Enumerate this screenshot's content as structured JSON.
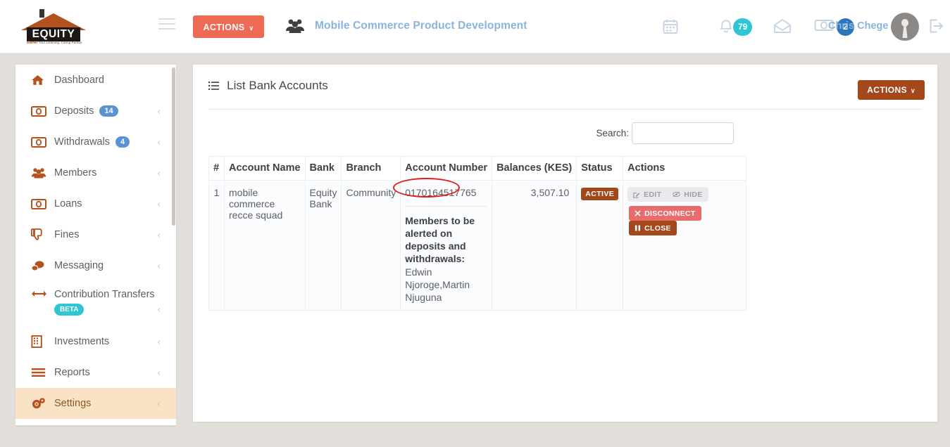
{
  "brand": {
    "logo_name": "EQUITY",
    "logo_tagline_bold": "Bank",
    "logo_tagline": "• Your Listening, Caring Partner",
    "accent_salmon": "#ee6a55",
    "accent_brown": "#a4481b",
    "accent_teal": "#2ec6d4",
    "accent_blue": "#2a78bb",
    "highlight_peach": "#fae3c4",
    "annotation_red": "#e01b1b"
  },
  "header": {
    "menu_icon": "hamburger-icon",
    "actions_label": "ACTIONS",
    "actions_caret": "∨",
    "group_icon": "users-group-icon",
    "team_name": "Mobile Commerce Product Development",
    "calendar_icon": "calendar-icon",
    "bell_icon": "bell-icon",
    "notifications_count": "79",
    "mail_icon": "envelope-open-icon",
    "money_icon": "banknote-icon",
    "money_count": "2",
    "user_name": "Chris Chege",
    "avatar_icon": "user-avatar",
    "logout_icon": "sign-out-icon"
  },
  "sidebar": {
    "items": [
      {
        "label": "Dashboard",
        "icon": "home-icon",
        "badge": null,
        "chevron": false,
        "active": false
      },
      {
        "label": "Deposits",
        "icon": "banknote-icon",
        "badge": "14",
        "chevron": true,
        "active": false
      },
      {
        "label": "Withdrawals",
        "icon": "banknote-icon",
        "badge": "4",
        "chevron": true,
        "active": false
      },
      {
        "label": "Members",
        "icon": "users-group-icon",
        "badge": null,
        "chevron": true,
        "active": false
      },
      {
        "label": "Loans",
        "icon": "banknote-icon",
        "badge": null,
        "chevron": true,
        "active": false
      },
      {
        "label": "Fines",
        "icon": "thumbs-down-icon",
        "badge": null,
        "chevron": true,
        "active": false
      },
      {
        "label": "Messaging",
        "icon": "chat-bubbles-icon",
        "badge": null,
        "chevron": true,
        "active": false
      },
      {
        "label": "Contribution Transfers",
        "icon": "arrows-left-right-icon",
        "badge": "BETA",
        "chevron": true,
        "active": false
      },
      {
        "label": "Investments",
        "icon": "building-icon",
        "badge": null,
        "chevron": true,
        "active": false
      },
      {
        "label": "Reports",
        "icon": "bars-icon",
        "badge": null,
        "chevron": true,
        "active": false
      },
      {
        "label": "Settings",
        "icon": "gears-icon",
        "badge": null,
        "chevron": true,
        "active": true
      }
    ],
    "chevron_glyph": "‹"
  },
  "main": {
    "page_title": "List Bank Accounts",
    "page_title_icon": "list-ul-icon",
    "actions_label": "ACTIONS",
    "actions_caret": "∨",
    "search": {
      "label": "Search:",
      "value": "",
      "placeholder": ""
    },
    "table": {
      "columns": [
        "#",
        "Account Name",
        "Bank",
        "Branch",
        "Account Number",
        "Balances (KES)",
        "Status",
        "Actions"
      ],
      "rows": [
        {
          "index": "1",
          "account_name": "mobile commerce recce squad",
          "bank": "Equity Bank",
          "branch": "Community",
          "account_number": "0170164517765",
          "alert_title": "Members to be alerted on deposits and withdrawals:",
          "alert_names": "Edwin Njoroge,Martin Njuguna",
          "balance": "3,507.10",
          "status": "ACTIVE",
          "actions": [
            {
              "label": "EDIT",
              "icon": "pencil-square-icon",
              "style": "light",
              "highlighted": true
            },
            {
              "label": "HIDE",
              "icon": "eye-slash-icon",
              "style": "light",
              "highlighted": false
            },
            {
              "label": "DISCONNECT",
              "icon": "times-icon",
              "style": "danger",
              "highlighted": false
            },
            {
              "label": "CLOSE",
              "icon": "pause-icon",
              "style": "brown",
              "highlighted": false
            }
          ]
        }
      ]
    }
  },
  "annotation": {
    "shape": "red-ellipse",
    "target": "edit-button"
  }
}
